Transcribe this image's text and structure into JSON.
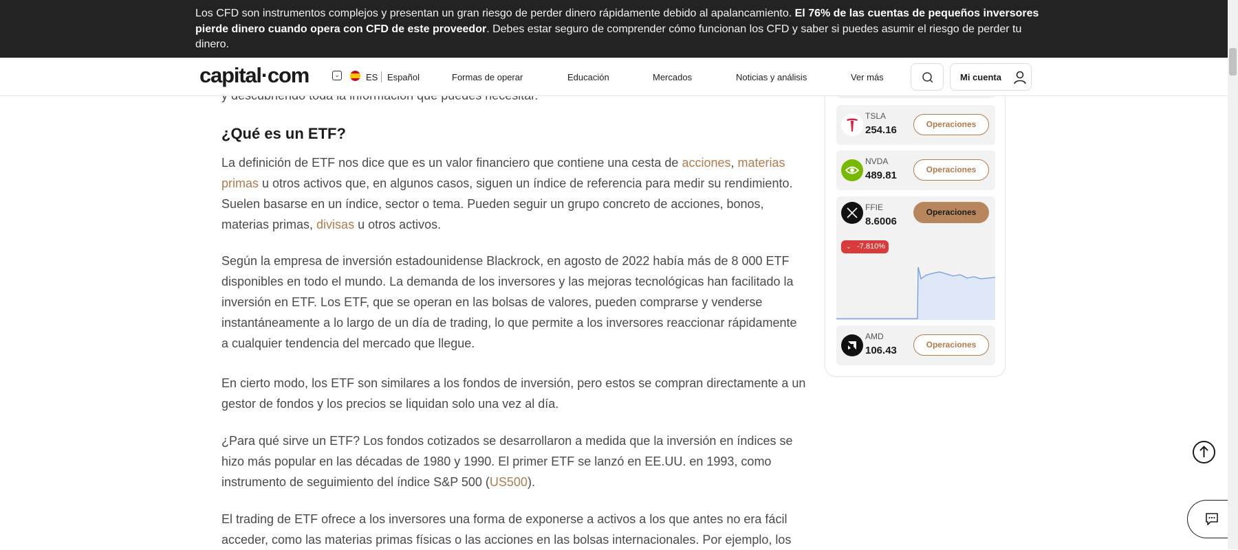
{
  "risk_banner": {
    "text_start": "Los CFD son instrumentos complejos y presentan un gran riesgo de perder dinero rápidamente debido al apalancamiento. ",
    "text_bold": "El 76% de las cuentas de pequeños inversores pierde dinero cuando opera con CFD de este proveedor",
    "text_end": ". Debes estar seguro de comprender cómo funcionan los CFD y saber si puedes asumir el riesgo de perder tu dinero."
  },
  "header": {
    "logo": "capital·com",
    "language_code": "ES",
    "language_name": "Español",
    "nav_items": [
      "Formas de operar",
      "Educación",
      "Mercados",
      "Noticias y análisis",
      "Ver más"
    ],
    "account_label": "Mi cuenta"
  },
  "article": {
    "partial_line": "y descubriendo toda la información que puedes necesitar.",
    "heading": "¿Qué es un ETF?",
    "p1": {
      "before": "La definición de ETF nos dice que es un valor financiero que contiene una cesta de ",
      "link1": "acciones",
      "sep": ", ",
      "link2": "materias primas",
      "middle": " u otros activos que, en algunos casos, siguen un índice de referencia para medir su rendimiento. Suelen basarse en un índice, sector o tema. Pueden seguir un grupo concreto de acciones, bonos, materias primas, ",
      "link3": "divisas",
      "after": " u otros activos."
    },
    "p2": "Según la empresa de inversión estadounidense Blackrock, en agosto de 2022 había más de 8 000 ETF disponibles en todo el mundo. La demanda de los inversores y las mejoras tecnológicas han facilitado la inversión en ETF. Los ETF, que se operan en las bolsas de valores, pueden comprarse y venderse instantáneamente a lo largo de un día de trading, lo que permite a los inversores reaccionar rápidamente a cualquier tendencia del mercado que llegue.",
    "p3": "En cierto modo, los ETF son similares a los fondos de inversión, pero estos se compran directamente a un gestor de fondos y los precios se liquidan solo una vez al día.",
    "p4": {
      "before": "¿Para qué sirve un ETF? Los fondos cotizados se desarrollaron a medida que la inversión en índices se hizo más popular en las décadas de 1980 y 1990. El primer ETF se lanzó en EE.UU. en 1993, como instrumento de seguimiento del índice S&P 500 (",
      "link": "US500",
      "after": ")."
    },
    "p5": "El trading de ETF ofrece a los inversores una forma de exponerse a activos a los que antes no era fácil acceder, como las materias primas físicas o las acciones en las bolsas internacionales. Por ejemplo, los"
  },
  "sidebar": {
    "button_label": "Operaciones",
    "tickers": [
      {
        "symbol": "TSLA",
        "price": "254.16",
        "logo": "tesla-icon"
      },
      {
        "symbol": "NVDA",
        "price": "489.81",
        "logo": "nvidia-icon"
      },
      {
        "symbol": "FFIE",
        "price": "8.6006",
        "logo": "ffie-icon",
        "change": "-7.810%"
      },
      {
        "symbol": "AMD",
        "price": "106.43",
        "logo": "amd-icon"
      }
    ],
    "colors": {
      "accent": "#b37a4c",
      "negative": "#d93a3a",
      "chart_line": "#6f9be0"
    }
  }
}
